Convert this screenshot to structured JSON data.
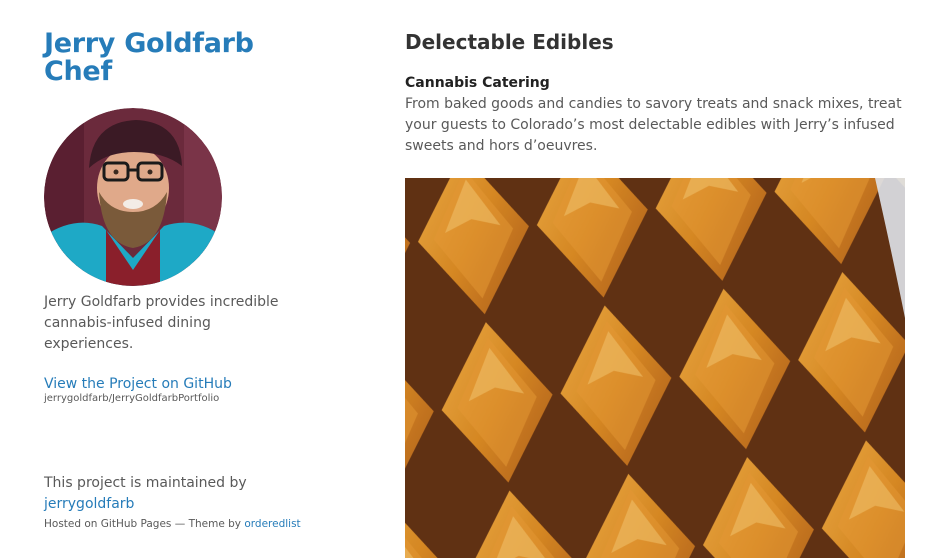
{
  "header": {
    "title_line1": "Jerry Goldfarb",
    "title_line2": "Chef",
    "tagline": "Jerry Goldfarb provides incredible cannabis-infused dining experiences."
  },
  "project": {
    "view_link": "View the Project on GitHub",
    "repo": "jerrygoldfarb/JerryGoldfarbPortfolio"
  },
  "maintainer": {
    "text": "This project is maintained by",
    "user": "jerrygoldfarb"
  },
  "footer": {
    "hosted": "Hosted on GitHub Pages — Theme by ",
    "theme_author": "orderedlist"
  },
  "main": {
    "heading": "Delectable Edibles",
    "subheading": "Cannabis Catering",
    "description": "From baked goods and candies to savory treats and snack mixes, treat your guests to Colorado’s most delectable edibles with Jerry’s infused sweets and hors d’oeuvres."
  },
  "colors": {
    "link": "#267CB9",
    "text": "#595959",
    "heading": "#333333"
  }
}
